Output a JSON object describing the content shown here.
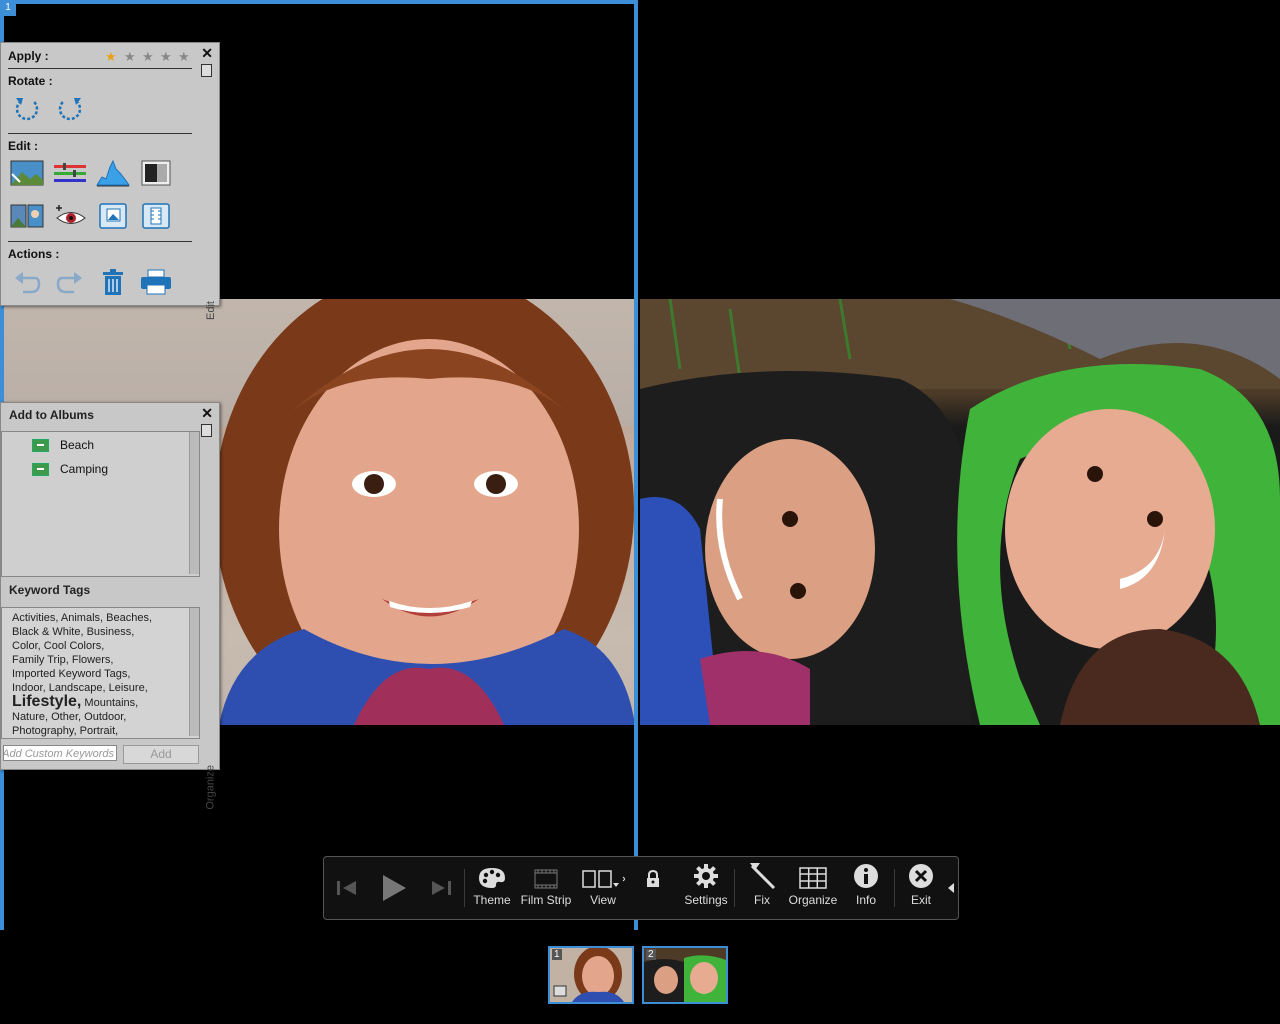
{
  "panes": {
    "left_number": "1"
  },
  "quick_panel": {
    "apply_label": "Apply :",
    "rating": 1,
    "max_rating": 5,
    "rotate_label": "Rotate :",
    "edit_label": "Edit :",
    "actions_label": "Actions :",
    "tab_label": "Edit",
    "icons": {
      "rotate_left": "rotate-left-icon",
      "rotate_right": "rotate-right-icon",
      "auto_smart_fix": "auto-smart-fix-icon",
      "levels": "levels-icon",
      "histogram": "histogram-icon",
      "contrast": "contrast-icon",
      "photomerge": "photomerge-icon",
      "red_eye": "red-eye-icon",
      "full_edit": "full-edit-icon",
      "video_edit": "video-edit-icon",
      "undo": "undo-icon",
      "redo": "redo-icon",
      "delete": "trash-icon",
      "print": "printer-icon"
    }
  },
  "albums_panel": {
    "title": "Add to Albums",
    "albums": [
      "Beach",
      "Camping"
    ],
    "keyword_title": "Keyword Tags",
    "keywords_line1": "Activities,   Animals,   Beaches,",
    "keywords_line2": "Black & White,   Business,",
    "keywords_line3": "Color,   Cool Colors,",
    "keywords_line4": "Family Trip,   Flowers,",
    "keywords_line5": "Imported Keyword Tags,",
    "keywords_line6": "Indoor,   Landscape,   Leisure,",
    "keyword_big": "Lifestyle,",
    "keywords_line7": "Mountains,",
    "keywords_line8": "Nature,   Other,   Outdoor,",
    "keywords_line9": "Photography,   Portrait,",
    "custom_placeholder": "Add Custom Keywords",
    "add_label": "Add",
    "tab_label": "Organize"
  },
  "control_bar": {
    "theme_label": "Theme",
    "filmstrip_label": "Film Strip",
    "view_label": "View",
    "settings_label": "Settings",
    "fix_label": "Fix",
    "organize_label": "Organize",
    "info_label": "Info",
    "exit_label": "Exit"
  },
  "filmstrip": {
    "thumbs": [
      {
        "number": "1"
      },
      {
        "number": "2"
      }
    ]
  },
  "colors": {
    "accent": "#3c8fd6",
    "panel_bg": "#c8c8c8",
    "star": "#e8a21a",
    "album_green": "#3c9a4a"
  }
}
